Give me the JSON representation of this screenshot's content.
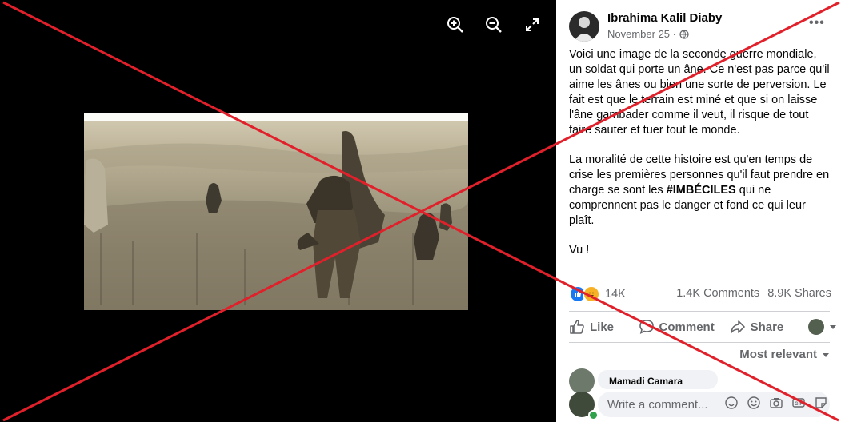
{
  "viewer": {
    "controls": [
      {
        "name": "zoom-in-icon"
      },
      {
        "name": "zoom-out-icon"
      },
      {
        "name": "fullscreen-icon"
      }
    ]
  },
  "post": {
    "author": "Ibrahima Kalil Diaby",
    "date": "November 25 ·",
    "privacy_icon": "globe-icon",
    "more_label": "•••",
    "paragraph1": "Voici une image de la seconde guerre mondiale, un soldat qui porte un âne. Ce n'est pas parce qu'il aime les ânes ou bien une sorte de perversion. Le fait est que le terrain est miné et que si on laisse l'âne gambader comme il veut, il risque de tout faire sauter et tuer tout le monde.",
    "paragraph2_before": "La moralité de cette histoire est qu'en temps de crise les premières personnes qu'il faut prendre en charge se sont les ",
    "paragraph2_hashtag": "#IMBÉCILES",
    "paragraph2_after": " qui ne comprennent pas le danger et fond ce qui leur plaît.",
    "paragraph3": "Vu !"
  },
  "reactions": {
    "count": "14K",
    "comments": "1.4K Comments",
    "shares": "8.9K Shares",
    "colors": {
      "like": "#1877f2",
      "haha": "#f7b125"
    }
  },
  "actions": {
    "like": "Like",
    "comment": "Comment",
    "share": "Share"
  },
  "comments": {
    "sort_label": "Most relevant",
    "first_author": "Mamadi Camara",
    "input_placeholder": "Write a comment..."
  },
  "overlay": {
    "cross_color": "#e0202a"
  }
}
